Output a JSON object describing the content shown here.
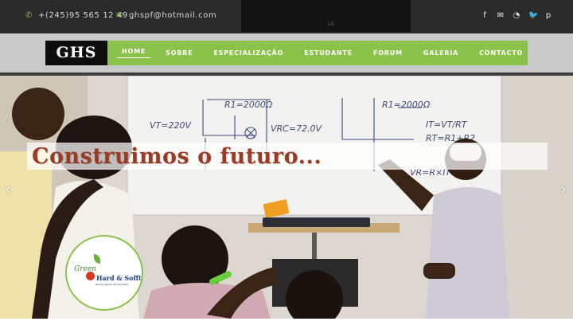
{
  "topbar": {
    "phone": "+(245)95 565 12 49",
    "email": "ghspf@hotmail.com",
    "phone_icon": "phone-icon",
    "email_icon": "envelope-icon",
    "social": [
      {
        "name": "facebook-icon",
        "glyph": "f"
      },
      {
        "name": "email-icon",
        "glyph": "✉"
      },
      {
        "name": "rss-icon",
        "glyph": "◔"
      },
      {
        "name": "twitter-icon",
        "glyph": "🐦"
      },
      {
        "name": "pinterest-icon",
        "glyph": "p"
      }
    ],
    "center_text": "LG"
  },
  "nav": {
    "logo": "GHS",
    "items": [
      "HOME",
      "SOBRE",
      "ESPECIALIZAÇÃO",
      "ESTUDANTE",
      "FORUM",
      "GALERIA",
      "CONTACTO"
    ],
    "active_index": 0
  },
  "hero": {
    "headline": "Construimos o futuro...",
    "prev_arrow": "‹",
    "next_arrow": "›",
    "board_text": {
      "vt": "VT=220V",
      "r1": "R1=2000Ω",
      "r1b": "R1=2000Ω",
      "vrc": "VRC=72.0V",
      "it": "IT=VT/RT",
      "rt": "RT=R1+R2",
      "vr": "VR=R×IT"
    },
    "sign_text": "—"
  },
  "badge": {
    "green": "Green",
    "brand": "Hard & Sofft",
    "subtitle": "Escola Superior de Informática"
  },
  "colors": {
    "accent": "#8bc34a",
    "topbar": "#2a2a2a",
    "headline": "#9a3b24"
  }
}
